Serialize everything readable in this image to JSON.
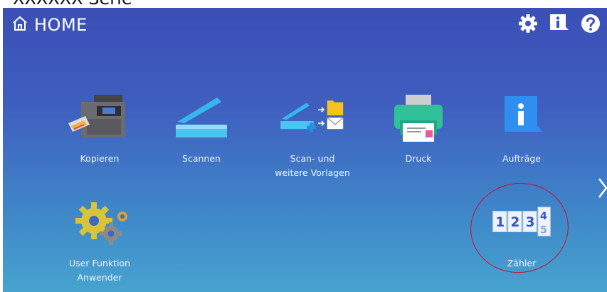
{
  "caption": "XXXXXX Serie",
  "header": {
    "home_label": "HOME",
    "icons": [
      "home-icon",
      "settings-gear-icon",
      "info-icon",
      "help-question-icon"
    ]
  },
  "tiles": [
    {
      "label_lines": [
        "Kopieren"
      ],
      "icon": "copier-icon"
    },
    {
      "label_lines": [
        "Scannen"
      ],
      "icon": "scanner-icon"
    },
    {
      "label_lines": [
        "Scan- und",
        "weitere Vorlagen"
      ],
      "icon": "scan-templates-icon"
    },
    {
      "label_lines": [
        "Druck"
      ],
      "icon": "printer-icon"
    },
    {
      "label_lines": [
        "Aufträge"
      ],
      "icon": "jobs-info-icon"
    },
    {
      "label_lines": [
        "User Funktion",
        "Anwender"
      ],
      "icon": "gears-icon"
    },
    {
      "label_lines": [
        "Zähler"
      ],
      "icon": "counter-icon",
      "counter_digits": [
        "1",
        "2",
        "3",
        "4",
        "5"
      ]
    }
  ],
  "colors": {
    "bg_top": "#3b4fb6",
    "bg_bottom": "#47a3cf",
    "text": "#ffffff",
    "annotation": "#c8102e"
  }
}
